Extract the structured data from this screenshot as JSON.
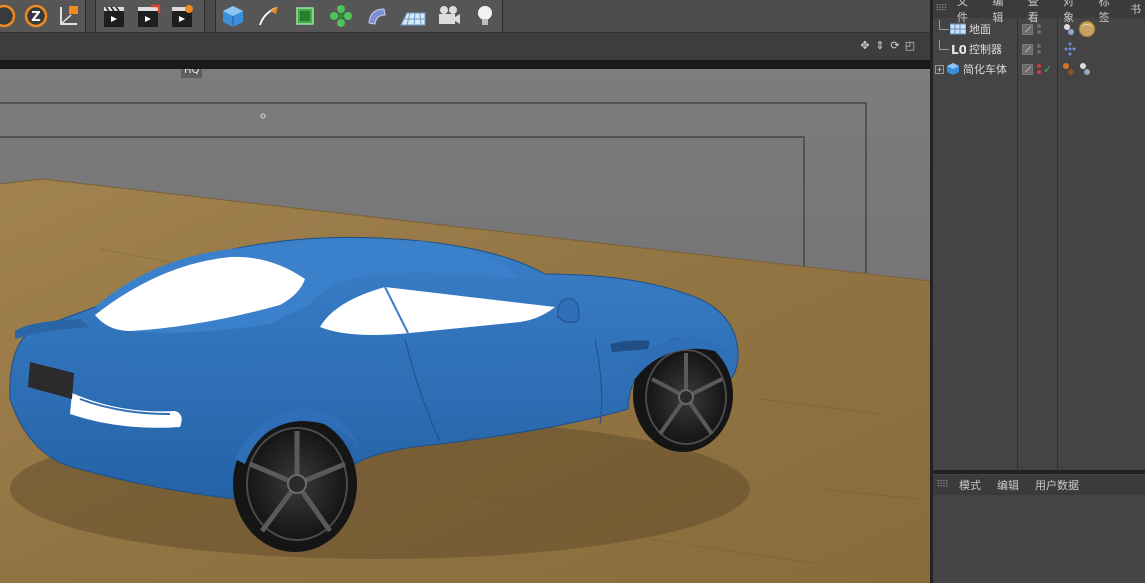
{
  "toolbar": {
    "groups": [
      {
        "icons": [
          "rotate-icon",
          "z-axis-lock-icon",
          "coordinate-system-icon"
        ]
      },
      {
        "icons": [
          "render-view-icon",
          "render-to-picture-viewer-icon",
          "render-settings-icon"
        ]
      },
      {
        "icons": [
          "cube-object-icon",
          "pen-spline-icon",
          "subdivision-surface-icon",
          "array-cloner-icon",
          "deformer-bend-icon",
          "floor-environment-icon",
          "camera-icon",
          "light-icon"
        ]
      }
    ]
  },
  "viewport": {
    "hq_label": "HQ",
    "nav_icons": [
      "move-view-icon",
      "zoom-view-icon",
      "rotate-view-icon",
      "maximize-view-icon"
    ],
    "colors": {
      "background": "#7d7d7d",
      "floor": "#9a7c4a",
      "car_body": "#2f6fb8",
      "glass": "#ffffff",
      "tire": "#1c1c1c"
    }
  },
  "object_manager": {
    "menu": [
      "文件",
      "编辑",
      "查看",
      "对象",
      "标签",
      "书"
    ],
    "objects": [
      {
        "name": "地面",
        "icon": "floor-object-icon",
        "tags": [
          "material-tag-icon",
          "sphere-material-icon"
        ],
        "expandable": false
      },
      {
        "name": "控制器",
        "icon": "null-object-icon",
        "tags": [
          "constraint-tag-icon"
        ],
        "expandable": false
      },
      {
        "name": "简化车体",
        "icon": "polygon-object-icon",
        "tags": [
          "material-tag-icon",
          "texture-tag-icon"
        ],
        "expandable": true,
        "checked": true
      }
    ]
  },
  "attribute_manager": {
    "menu": [
      "模式",
      "编辑",
      "用户数据"
    ]
  }
}
